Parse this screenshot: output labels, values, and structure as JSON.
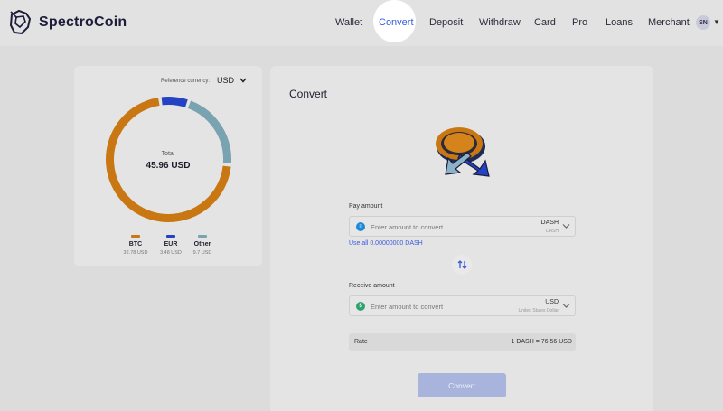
{
  "header": {
    "brand": "SpectroCoin",
    "nav": [
      {
        "label": "Wallet",
        "active": false
      },
      {
        "label": "Convert",
        "active": true
      },
      {
        "label": "Deposit",
        "active": false
      },
      {
        "label": "Withdraw",
        "active": false
      },
      {
        "label": "Card",
        "active": false
      },
      {
        "label": "Pro",
        "active": false
      },
      {
        "label": "Loans",
        "active": false
      },
      {
        "label": "Merchant",
        "active": false
      }
    ],
    "user_initials": "SN"
  },
  "portfolio": {
    "reference_label": "Reference currency:",
    "reference_currency": "USD",
    "total_label": "Total",
    "total_value": "45.96 USD",
    "assets": [
      {
        "name": "BTC",
        "value": "32.78 USD",
        "color": "#c97712",
        "amount_usd": 32.78
      },
      {
        "name": "EUR",
        "value": "3.48 USD",
        "color": "#2442c4",
        "amount_usd": 3.48
      },
      {
        "name": "Other",
        "value": "9.7 USD",
        "color": "#79a3b1",
        "amount_usd": 9.7
      }
    ]
  },
  "convert": {
    "title": "Convert",
    "pay": {
      "label": "Pay amount",
      "placeholder": "Enter amount to convert",
      "currency": "DASH",
      "currency_name": "DASH",
      "use_all": "Use all 0.00000000 DASH"
    },
    "receive": {
      "label": "Receive amount",
      "placeholder": "Enter amount to convert",
      "currency": "USD",
      "currency_name": "United States Dollar"
    },
    "rate_label": "Rate",
    "rate_value": "1 DASH = 76.56 USD",
    "button_label": "Convert"
  },
  "colors": {
    "accent": "#3b5bdb",
    "btc": "#c97712",
    "eur": "#2442c4",
    "other": "#79a3b1",
    "usd_icon": "#2ea36b",
    "dash_icon": "#1e88d8"
  },
  "icons": {
    "swap": "swap-vertical-icon",
    "chevron": "chevron-down-icon",
    "dash": "dash-coin-icon",
    "usd": "usd-coin-icon"
  }
}
